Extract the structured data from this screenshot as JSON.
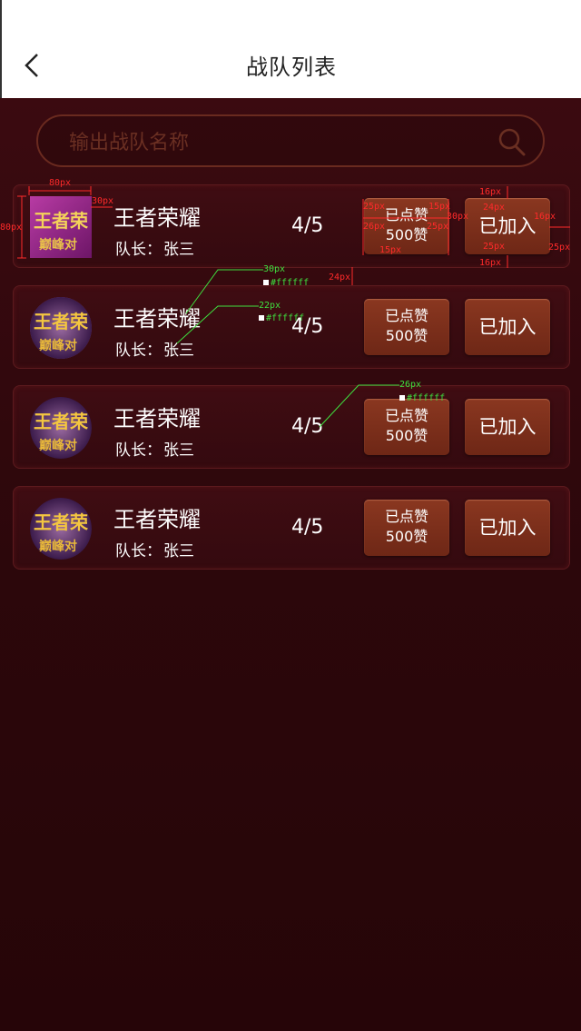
{
  "header": {
    "title": "战队列表",
    "back_icon": "chevron-left-icon"
  },
  "search": {
    "placeholder": "输出战队名称",
    "icon": "search-icon"
  },
  "teams": [
    {
      "name": "王者荣耀",
      "captain_label": "队长：",
      "captain": "张三",
      "count": "4/5",
      "like_line1": "已点赞",
      "like_line2": "500赞",
      "join": "已加入"
    },
    {
      "name": "王者荣耀",
      "captain_label": "队长：",
      "captain": "张三",
      "count": "4/5",
      "like_line1": "已点赞",
      "like_line2": "500赞",
      "join": "已加入"
    },
    {
      "name": "王者荣耀",
      "captain_label": "队长：",
      "captain": "张三",
      "count": "4/5",
      "like_line1": "已点赞",
      "like_line2": "500赞",
      "join": "已加入"
    },
    {
      "name": "王者荣耀",
      "captain_label": "队长：",
      "captain": "张三",
      "count": "4/5",
      "like_line1": "已点赞",
      "like_line2": "500赞",
      "join": "已加入"
    }
  ],
  "avatar_text": {
    "line1": "王者荣",
    "line2": "巅峰对"
  },
  "annotations": {
    "a80w": "80px",
    "a80h": "80px",
    "a30": "30px",
    "a16a": "16px",
    "a24a": "24px",
    "a25a": "25px",
    "a26a": "26px",
    "a15a": "15px",
    "a25b": "25px",
    "a30b": "30px",
    "a16b": "16px",
    "a24b": "24px",
    "a25c": "25px",
    "a16c": "16px",
    "a25d": "25px",
    "a15b": "15px",
    "a30c": "30px",
    "a22": "22px",
    "a26b": "26px",
    "hex1": "#ffffff",
    "hex2": "#ffffff",
    "hex3": "#ffffff"
  },
  "colors": {
    "background": "#2a0609",
    "button": "#7c2f1b",
    "border": "#5c1a1e",
    "text": "#ffffff"
  }
}
